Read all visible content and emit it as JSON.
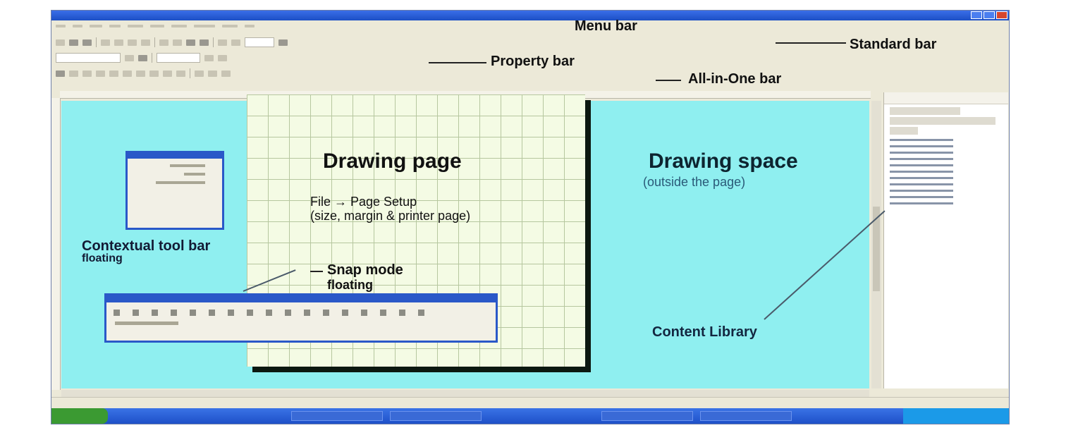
{
  "labels": {
    "menu_bar": "Menu bar",
    "standard_bar": "Standard bar",
    "property_bar": "Property bar",
    "all_in_one_bar": "All-in-One bar",
    "drawing_page_title": "Drawing page",
    "drawing_page_note_line1": "File → Page Setup",
    "drawing_page_note_line2": "(size, margin & printer page)",
    "drawing_space_title": "Drawing space",
    "drawing_space_note": "(outside the page)",
    "toolbox_floating_line1": "Contextual tool bar",
    "toolbox_floating_line2": "floating",
    "snap_mode_line1": "Snap mode",
    "snap_mode_line2": "floating",
    "content_library": "Content Library"
  }
}
